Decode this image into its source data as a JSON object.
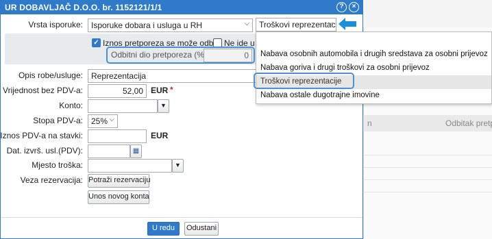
{
  "dialog": {
    "title": "UR DOBAVLJAČ D.O.O. br. 1152121/1/1",
    "help_icon": "?",
    "close_icon": "×"
  },
  "form": {
    "vrsta_label": "Vrsta isporuke:",
    "vrsta_value": "Isporuke dobara i usluga u RH",
    "vrsta2_value": "Troškovi reprezentacij",
    "check1_label": "Iznos pretporeza se može odbiti",
    "check2_label": "Ne ide u P",
    "odbitni_label": "Odbitni dio pretporeza (%):",
    "odbitni_value": "0",
    "opis_label": "Opis robe/usluge:",
    "opis_value": "Reprezentacija",
    "vrijednost_label": "Vrijednost bez PDV-a:",
    "vrijednost_value": "52,00",
    "currency": "EUR",
    "required_mark": "*",
    "konto_label": "Konto:",
    "konto_value": "",
    "stopa_label": "Stopa PDV-a:",
    "stopa_value": "25%",
    "iznos_label": "Iznos PDV-a na stavki:",
    "iznos_value": "",
    "iznos_currency": "EUR",
    "datum_label": "Dat. izvrš. usl.(PDV):",
    "datum_value": "",
    "mjesto_label": "Mjesto troška:",
    "mjesto_value": "",
    "veza_label": "Veza rezervacija:",
    "potrazi_button": "Potraži rezervaciju",
    "unos_button": "Unos novog konta",
    "ok_button": "U redu",
    "cancel_button": "Odustani"
  },
  "dropdown": {
    "items": [
      "Nabava osobnih automobila i drugih sredstava za osobni prijevoz",
      "Nabava goriva i drugi troškovi za osobni prijevoz",
      "Troškovi reprezentacije",
      "Nabava ostale dugotrajne imovine"
    ],
    "selected_index": 2
  },
  "background": {
    "col1": "n",
    "col2": "Odbitak pretp"
  },
  "colors": {
    "accent": "#2f7ac9",
    "highlight": "#4a90d9",
    "arrow": "#1a8fe0"
  }
}
